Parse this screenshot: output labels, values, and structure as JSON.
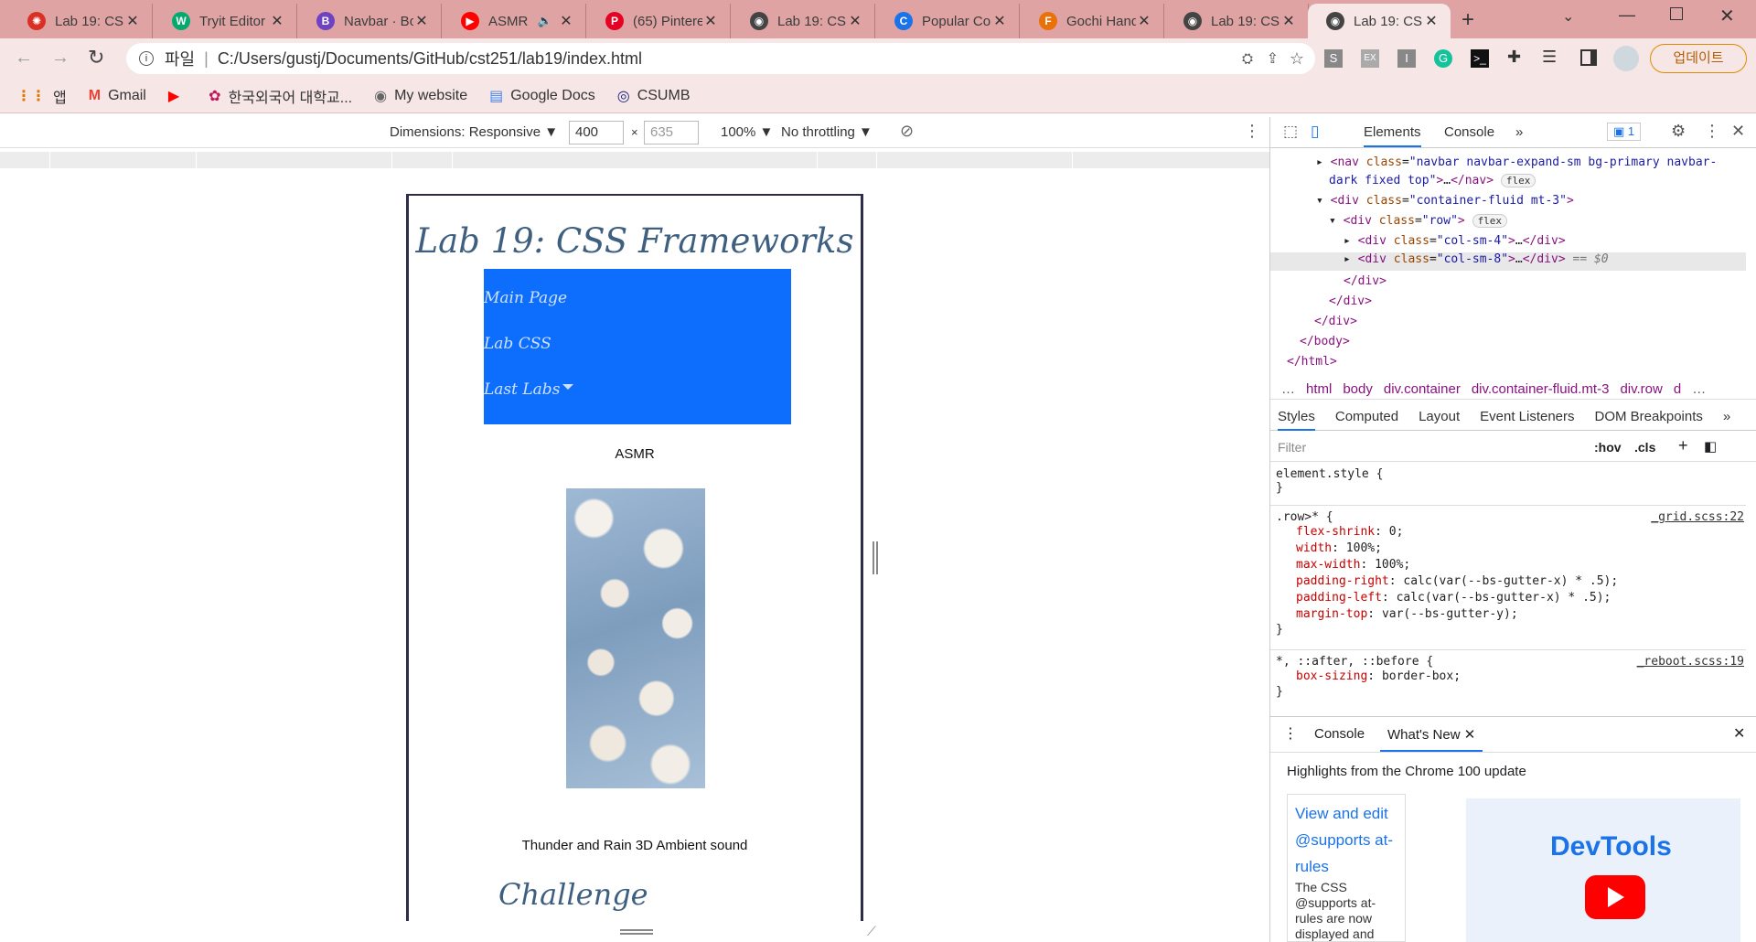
{
  "tabs": [
    {
      "title": "Lab 19: CS",
      "fav": "#d93025",
      "fav_glyph": "✺"
    },
    {
      "title": "Tryit Editor",
      "fav": "#04aa6d",
      "fav_glyph": "W"
    },
    {
      "title": "Navbar · Bo",
      "fav": "#6f42c1",
      "fav_glyph": "B"
    },
    {
      "title": "ASMR",
      "fav": "#ff0000",
      "fav_glyph": "▶",
      "muted": "🔈"
    },
    {
      "title": "(65) Pintere",
      "fav": "#e60023",
      "fav_glyph": "P"
    },
    {
      "title": "Lab 19: CS",
      "fav": "#444",
      "fav_glyph": "◉"
    },
    {
      "title": "Popular Co",
      "fav": "#1a73e8",
      "fav_glyph": "C"
    },
    {
      "title": "Gochi Hand",
      "fav": "#e8710a",
      "fav_glyph": "F"
    },
    {
      "title": "Lab 19: CS",
      "fav": "#444",
      "fav_glyph": "◉"
    },
    {
      "title": "Lab 19: CS",
      "fav": "#444",
      "fav_glyph": "◉"
    }
  ],
  "toolbar": {
    "scheme": "파일",
    "url": "C:/Users/gustj/Documents/GitHub/cst251/lab19/index.html",
    "update_label": "업데이트"
  },
  "bookmarks": [
    {
      "label": "앱",
      "icon": "apps-icon"
    },
    {
      "label": "Gmail",
      "icon": "gmail-icon"
    },
    {
      "label": "",
      "icon": "youtube-icon"
    },
    {
      "label": "한국외국어 대학교...",
      "icon": "hufs-icon"
    },
    {
      "label": "My website",
      "icon": "globe-icon"
    },
    {
      "label": "Google Docs",
      "icon": "docs-icon"
    },
    {
      "label": "CSUMB",
      "icon": "csumb-icon"
    }
  ],
  "devbar": {
    "dimensions": "Dimensions: Responsive ▼",
    "width": "400",
    "height": "635",
    "zoom": "100% ▼",
    "throttle": "No throttling ▼"
  },
  "page": {
    "title": "Lab 19: CSS Frameworks",
    "nav": [
      "Main Page",
      "Lab CSS",
      "Last Labs"
    ],
    "caption1": "ASMR",
    "caption2": "Thunder and Rain 3D Ambient sound",
    "heading2": "Challenge"
  },
  "devtools": {
    "tabs": [
      "Elements",
      "Console"
    ],
    "issues": "1",
    "breadcrumbs": [
      "…",
      "html",
      "body",
      "div.container",
      "div.container-fluid.mt-3",
      "div.row",
      "d",
      "…"
    ],
    "style_tabs": [
      "Styles",
      "Computed",
      "Layout",
      "Event Listeners",
      "DOM Breakpoints"
    ],
    "filter_placeholder": "Filter",
    "hov": ":hov",
    "cls": ".cls",
    "element_style": "element.style {",
    "row_selector": ".row>* {",
    "row_source": "_grid.scss:22",
    "row_props": [
      [
        "flex-shrink",
        "0;"
      ],
      [
        "width",
        "100%;"
      ],
      [
        "max-width",
        "100%;"
      ],
      [
        "padding-right",
        "calc(var(--bs-gutter-x) * .5);"
      ],
      [
        "padding-left",
        "calc(var(--bs-gutter-x) * .5);"
      ],
      [
        "margin-top",
        "var(--bs-gutter-y);"
      ]
    ],
    "reboot_selector": "*, ::after, ::before {",
    "reboot_source": "_reboot.scss:19",
    "reboot_prop": [
      "box-sizing",
      "border-box;"
    ],
    "drawer_tabs": [
      "Console",
      "What's New"
    ],
    "whatsnew_title": "Highlights from the Chrome 100 update",
    "card_link": "View and edit @supports at-rules",
    "card_text": "The CSS @supports at-rules are now displayed and",
    "promo": "DevTools"
  }
}
